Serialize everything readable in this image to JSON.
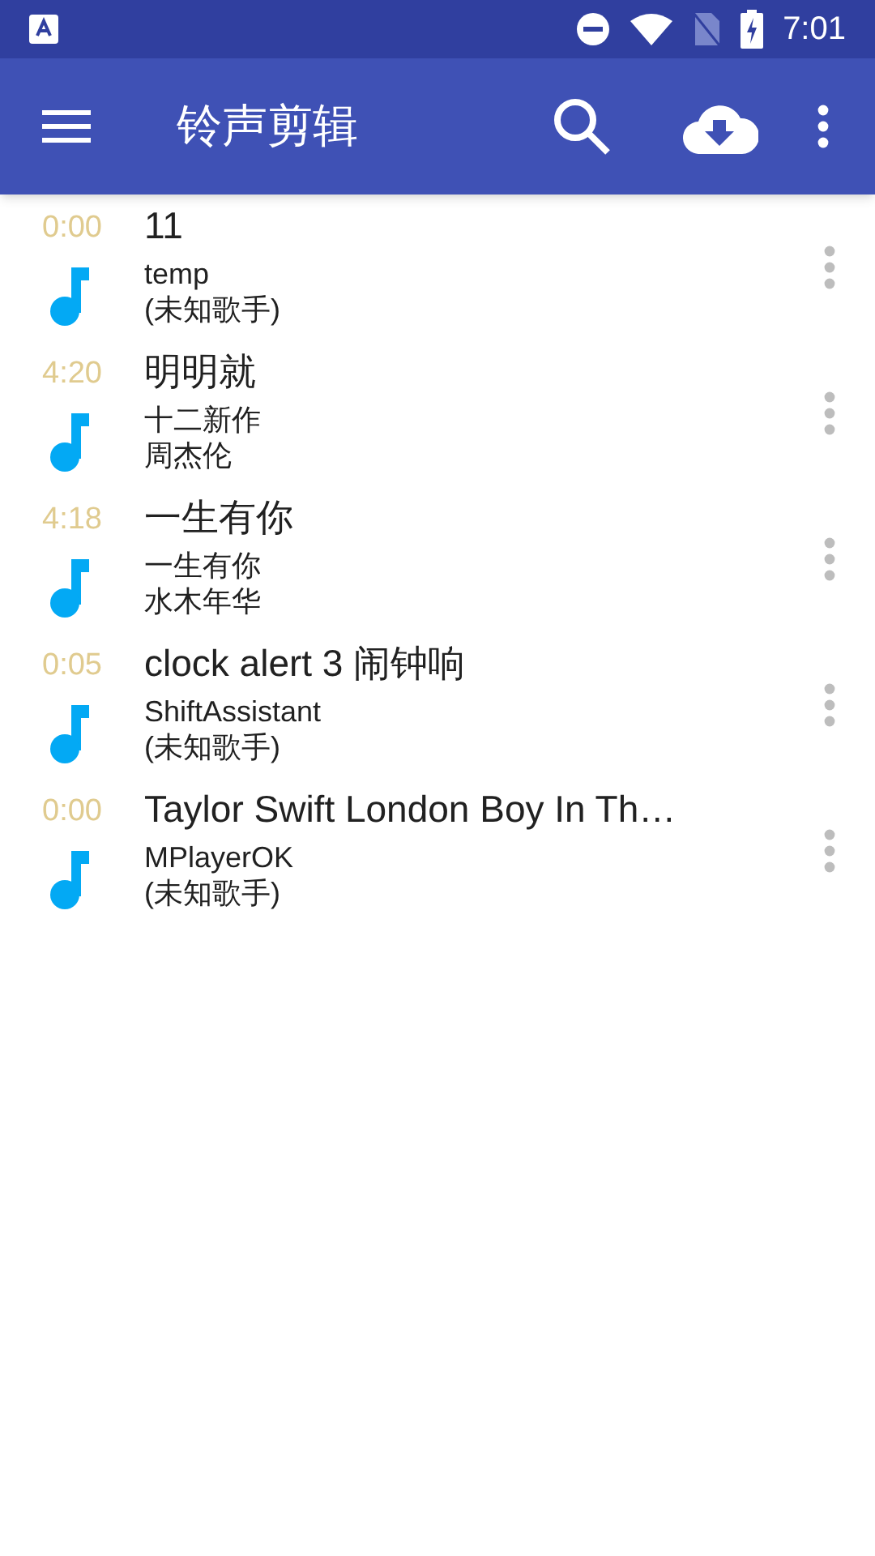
{
  "status_bar": {
    "time": "7:01"
  },
  "app_bar": {
    "title": "铃声剪辑"
  },
  "songs": [
    {
      "duration": "0:00",
      "title": "11",
      "album": "temp",
      "artist": "(未知歌手)"
    },
    {
      "duration": "4:20",
      "title": "明明就",
      "album": "十二新作",
      "artist": "周杰伦"
    },
    {
      "duration": "4:18",
      "title": "一生有你",
      "album": "一生有你",
      "artist": "水木年华"
    },
    {
      "duration": "0:05",
      "title": "clock alert 3 闹钟响",
      "album": "ShiftAssistant",
      "artist": "(未知歌手)"
    },
    {
      "duration": "0:00",
      "title": "Taylor Swift London Boy In Th…",
      "album": "MPlayerOK",
      "artist": "(未知歌手)"
    }
  ]
}
